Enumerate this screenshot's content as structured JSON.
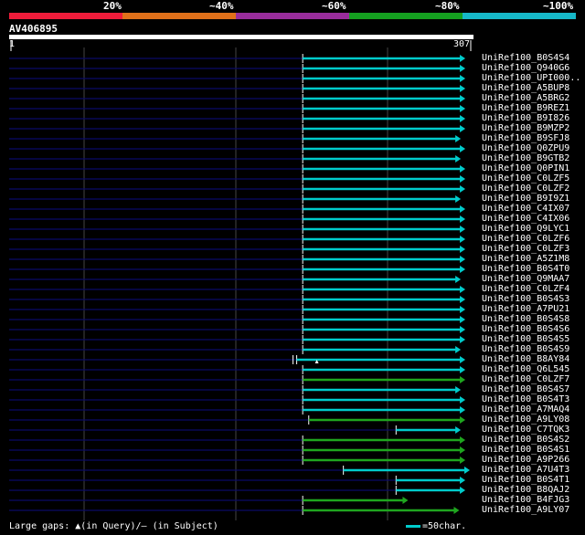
{
  "percent_labels": [
    "20%",
    "~40%",
    "~60%",
    "~80%",
    "~100%"
  ],
  "identity_colors": [
    "#ee1c3a",
    "#e0701a",
    "#992d9c",
    "#15a020",
    "#16b8c8"
  ],
  "query": {
    "name": "AV406895",
    "start": "1",
    "end": "307",
    "length": 307
  },
  "hits": [
    {
      "id": "UniRef100_B0S4S4",
      "color": "#00cccc",
      "qstart": 196,
      "qend": 304
    },
    {
      "id": "UniRef100_Q940G6",
      "color": "#00cccc",
      "qstart": 196,
      "qend": 304
    },
    {
      "id": "UniRef100_UPI000..",
      "color": "#00cccc",
      "qstart": 196,
      "qend": 304
    },
    {
      "id": "UniRef100_A5BUP8",
      "color": "#00cccc",
      "qstart": 196,
      "qend": 304
    },
    {
      "id": "UniRef100_A5BRG2",
      "color": "#00cccc",
      "qstart": 196,
      "qend": 304
    },
    {
      "id": "UniRef100_B9REZ1",
      "color": "#00cccc",
      "qstart": 196,
      "qend": 304
    },
    {
      "id": "UniRef100_B9I826",
      "color": "#00cccc",
      "qstart": 196,
      "qend": 304
    },
    {
      "id": "UniRef100_B9MZP2",
      "color": "#00cccc",
      "qstart": 196,
      "qend": 304
    },
    {
      "id": "UniRef100_B9SFJ8",
      "color": "#00cccc",
      "qstart": 196,
      "qend": 301
    },
    {
      "id": "UniRef100_Q0ZPU9",
      "color": "#00cccc",
      "qstart": 196,
      "qend": 304
    },
    {
      "id": "UniRef100_B9GTB2",
      "color": "#00cccc",
      "qstart": 196,
      "qend": 301
    },
    {
      "id": "UniRef100_Q0PIN1",
      "color": "#00cccc",
      "qstart": 196,
      "qend": 304
    },
    {
      "id": "UniRef100_C0LZF5",
      "color": "#00cccc",
      "qstart": 196,
      "qend": 304
    },
    {
      "id": "UniRef100_C0LZF2",
      "color": "#00cccc",
      "qstart": 196,
      "qend": 304
    },
    {
      "id": "UniRef100_B9I9Z1",
      "color": "#00cccc",
      "qstart": 196,
      "qend": 301
    },
    {
      "id": "UniRef100_C4IX07",
      "color": "#00cccc",
      "qstart": 196,
      "qend": 304
    },
    {
      "id": "UniRef100_C4IX06",
      "color": "#00cccc",
      "qstart": 196,
      "qend": 304
    },
    {
      "id": "UniRef100_Q9LYC1",
      "color": "#00cccc",
      "qstart": 196,
      "qend": 304
    },
    {
      "id": "UniRef100_C0LZF6",
      "color": "#00cccc",
      "qstart": 196,
      "qend": 304
    },
    {
      "id": "UniRef100_C0LZF3",
      "color": "#00cccc",
      "qstart": 196,
      "qend": 304
    },
    {
      "id": "UniRef100_A5Z1M8",
      "color": "#00cccc",
      "qstart": 196,
      "qend": 304
    },
    {
      "id": "UniRef100_B0S4T0",
      "color": "#00cccc",
      "qstart": 196,
      "qend": 304
    },
    {
      "id": "UniRef100_Q9MAA7",
      "color": "#00cccc",
      "qstart": 196,
      "qend": 301
    },
    {
      "id": "UniRef100_C0LZF4",
      "color": "#00cccc",
      "qstart": 196,
      "qend": 304
    },
    {
      "id": "UniRef100_B0S4S3",
      "color": "#00cccc",
      "qstart": 196,
      "qend": 304
    },
    {
      "id": "UniRef100_A7PU21",
      "color": "#00cccc",
      "qstart": 196,
      "qend": 304
    },
    {
      "id": "UniRef100_B0S4S8",
      "color": "#00cccc",
      "qstart": 196,
      "qend": 304
    },
    {
      "id": "UniRef100_B0S4S6",
      "color": "#00cccc",
      "qstart": 196,
      "qend": 304
    },
    {
      "id": "UniRef100_B0S4S5",
      "color": "#00cccc",
      "qstart": 196,
      "qend": 304
    },
    {
      "id": "UniRef100_B0S4S9",
      "color": "#00cccc",
      "qstart": 196,
      "qend": 301
    },
    {
      "id": "UniRef100_B8AY84",
      "color": "#00cccc",
      "qstart": 192,
      "qend": 304,
      "gap": true
    },
    {
      "id": "UniRef100_Q6L545",
      "color": "#00cccc",
      "qstart": 196,
      "qend": 304
    },
    {
      "id": "UniRef100_C0LZF7",
      "color": "#1fa61f",
      "qstart": 196,
      "qend": 304
    },
    {
      "id": "UniRef100_B0S4S7",
      "color": "#00cccc",
      "qstart": 196,
      "qend": 301
    },
    {
      "id": "UniRef100_B0S4T3",
      "color": "#00cccc",
      "qstart": 196,
      "qend": 304
    },
    {
      "id": "UniRef100_A7MAQ4",
      "color": "#00cccc",
      "qstart": 196,
      "qend": 304
    },
    {
      "id": "UniRef100_A9LY08",
      "color": "#1fa61f",
      "qstart": 200,
      "qend": 304
    },
    {
      "id": "UniRef100_C7TQK3",
      "color": "#00cccc",
      "qstart": 258,
      "qend": 301
    },
    {
      "id": "UniRef100_B0S4S2",
      "color": "#1fa61f",
      "qstart": 196,
      "qend": 304
    },
    {
      "id": "UniRef100_B0S4S1",
      "color": "#1fa61f",
      "qstart": 196,
      "qend": 304
    },
    {
      "id": "UniRef100_A9P266",
      "color": "#1fa61f",
      "qstart": 196,
      "qend": 304
    },
    {
      "id": "UniRef100_A7U4T3",
      "color": "#00cccc",
      "qstart": 223,
      "qend": 307
    },
    {
      "id": "UniRef100_B0S4T1",
      "color": "#00cccc",
      "qstart": 258,
      "qend": 304
    },
    {
      "id": "UniRef100_B8QAJ2",
      "color": "#00cccc",
      "qstart": 258,
      "qend": 304
    },
    {
      "id": "UniRef100_B4FJG3",
      "color": "#1fa61f",
      "qstart": 196,
      "qend": 266
    },
    {
      "id": "UniRef100_A9LY07",
      "color": "#1fa61f",
      "qstart": 196,
      "qend": 300
    }
  ],
  "footer": {
    "gaps_label": "Large gaps: ",
    "gap_query_symbol": "▲",
    "gap_query_text": "(in Query)/",
    "gap_subject_symbol": "–",
    "gap_subject_text": " (in Subject)",
    "scale_text": "=50char."
  }
}
